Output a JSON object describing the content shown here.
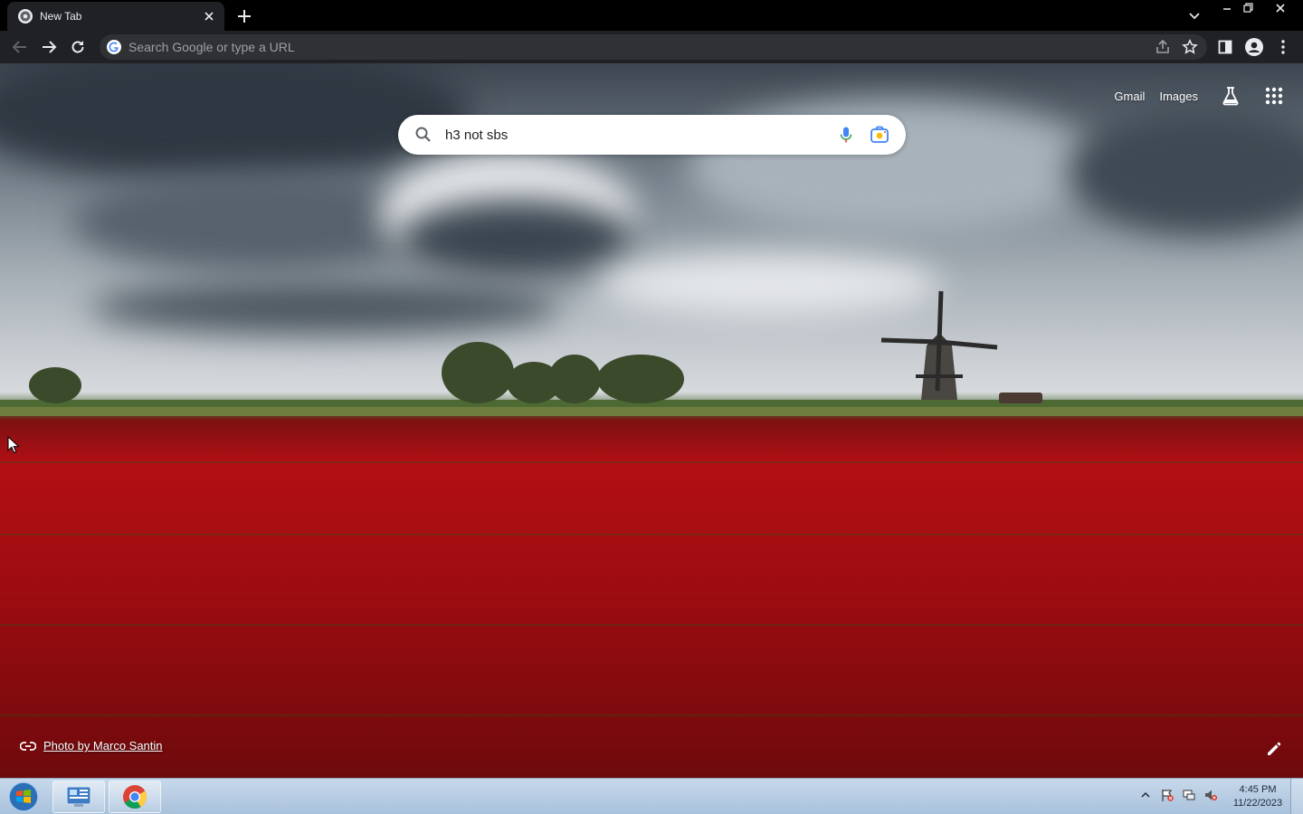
{
  "browser": {
    "tab": {
      "title": "New Tab"
    },
    "omnibox": {
      "placeholder": "Search Google or type a URL"
    }
  },
  "ntp": {
    "links": {
      "gmail": "Gmail",
      "images": "Images"
    },
    "search": {
      "query": "h3 not sbs"
    },
    "attribution": {
      "text": "Photo by Marco Santin"
    }
  },
  "taskbar": {
    "clock": {
      "time": "4:45 PM",
      "date": "11/22/2023"
    }
  },
  "colors": {
    "chrome_dark": "#202124",
    "omnibox_bg": "#303134",
    "google_blue": "#1a73e8",
    "taskbar": "#b9cde3"
  }
}
